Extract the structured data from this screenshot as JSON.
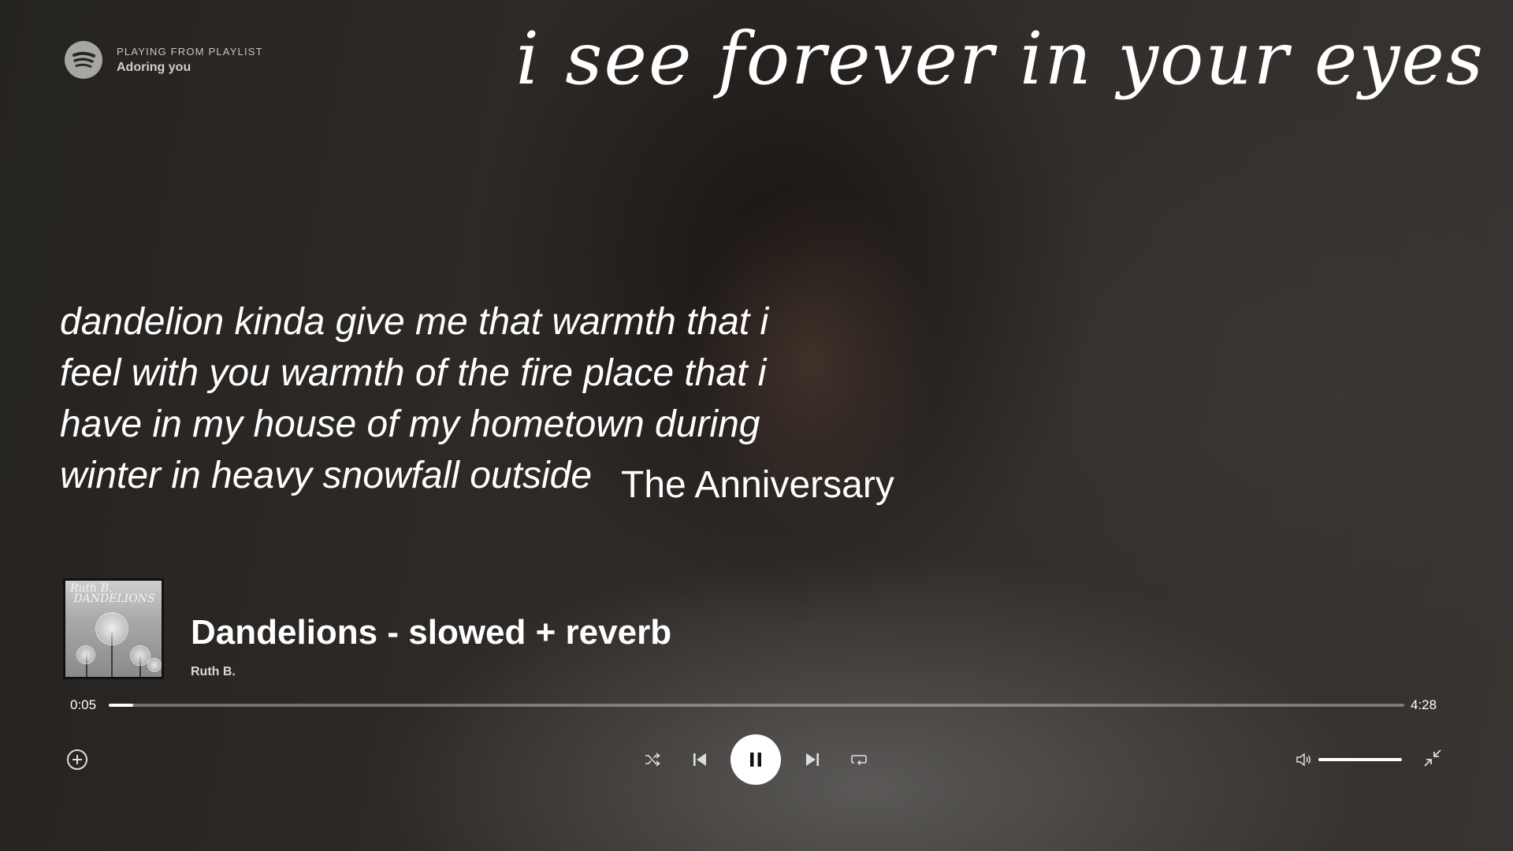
{
  "header": {
    "source_label": "PLAYING FROM PLAYLIST",
    "playlist_name": "Adoring you"
  },
  "tagline": "i see forever in your eyes",
  "lyrics": {
    "lines": [
      "dandelion kinda give me that warmth that i",
      "feel with you warmth of the fire place that i",
      "have in my house of my hometown during",
      "winter in heavy snowfall outside"
    ],
    "overlay_title": "The Anniversary"
  },
  "now_playing": {
    "album_art_text": "Ruth B. DANDELIONS",
    "title": "Dandelions - slowed + reverb",
    "artist": "Ruth B."
  },
  "playback": {
    "elapsed": "0:05",
    "total": "4:28",
    "progress_fraction": 0.019,
    "volume_fraction": 1.0,
    "is_playing": true
  },
  "icons": {
    "logo": "spotify-logo-icon",
    "add": "add-circle-icon",
    "shuffle": "shuffle-icon",
    "previous": "skip-previous-icon",
    "pause": "pause-icon",
    "next": "skip-next-icon",
    "repeat": "repeat-icon",
    "volume": "volume-icon",
    "minimize": "exit-fullscreen-icon"
  },
  "colors": {
    "background": "#2a2623",
    "text": "#ffffff",
    "muted": "#c7c7c7",
    "play_button": "#ffffff"
  }
}
